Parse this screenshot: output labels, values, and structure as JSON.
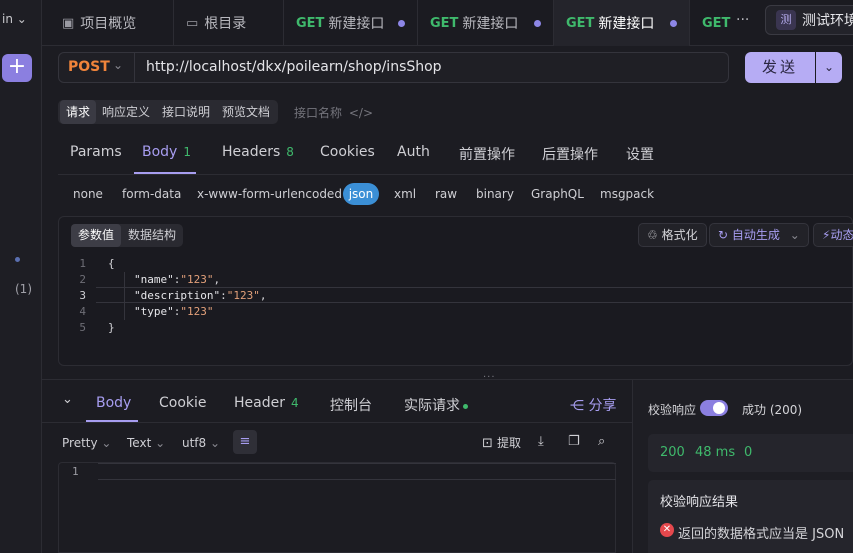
{
  "sidebar": {
    "head": "in",
    "add_label": "+",
    "count": "(1)"
  },
  "tabs": [
    {
      "icon": "overview-icon",
      "label": "项目概览"
    },
    {
      "icon": "folder-icon",
      "label": "根目录"
    },
    {
      "method": "GET",
      "label": "新建接口"
    },
    {
      "method": "GET",
      "label": "新建接口"
    },
    {
      "method": "GET",
      "label": "新建接口"
    },
    {
      "method": "GET",
      "label": ""
    }
  ],
  "tab_more": "···",
  "env": {
    "badge": "测",
    "label": "测试环境"
  },
  "request": {
    "method": "POST",
    "url": "http://localhost/dkx/poilearn/shop/insShop",
    "send_label": "发送"
  },
  "subtabs": [
    "请求",
    "响应定义",
    "接口说明",
    "预览文档"
  ],
  "iface_placeholder": "接口名称",
  "param_tabs": {
    "params": "Params",
    "body": "Body",
    "body_count": "1",
    "headers": "Headers",
    "headers_count": "8",
    "cookies": "Cookies",
    "auth": "Auth",
    "pre": "前置操作",
    "post": "后置操作",
    "settings": "设置"
  },
  "body_types": [
    "none",
    "form-data",
    "x-www-form-urlencoded",
    "json",
    "xml",
    "raw",
    "binary",
    "GraphQL",
    "msgpack"
  ],
  "editor_tabs": [
    "参数值",
    "数据结构"
  ],
  "editor_actions": {
    "format": "格式化",
    "autogen": "自动生成",
    "dynamic": "动态"
  },
  "code_lines": {
    "l1": "{",
    "l2_key": "\"name\"",
    "l2_val": "\"123\"",
    "l3_key": "\"description\"",
    "l3_val": "\"123\"",
    "l4_key": "\"type\"",
    "l4_val": "\"123\"",
    "l5": "}"
  },
  "line_numbers": [
    "1",
    "2",
    "3",
    "4",
    "5"
  ],
  "response": {
    "tabs": {
      "body": "Body",
      "cookie": "Cookie",
      "header": "Header",
      "header_count": "4",
      "console": "控制台",
      "actual": "实际请求"
    },
    "share": "分享",
    "pretty": "Pretty",
    "text": "Text",
    "encoding": "utf8",
    "extract": "提取",
    "line1": "1",
    "verify_label": "校验响应",
    "verify_status": "成功 (200)",
    "status_code": "200",
    "time": "48 ms",
    "size": "0",
    "result_title": "校验响应结果",
    "result_error": "返回的数据格式应当是 JSON"
  }
}
